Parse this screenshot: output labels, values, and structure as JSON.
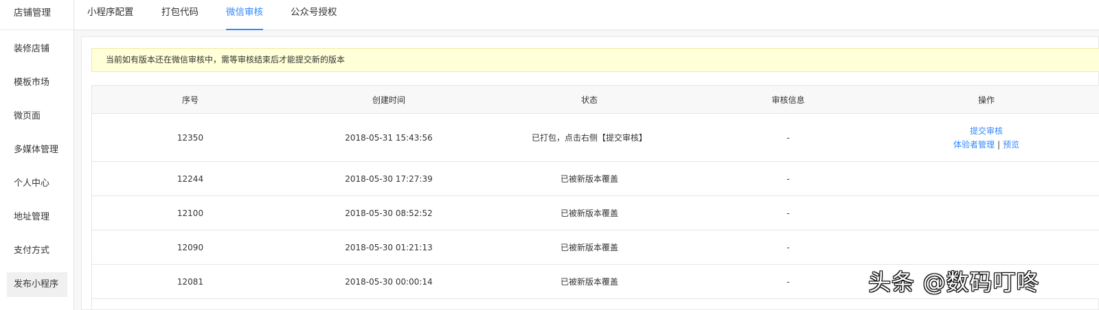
{
  "sidebar": {
    "title": "店铺管理",
    "items": [
      {
        "label": "装修店铺"
      },
      {
        "label": "模板市场"
      },
      {
        "label": "微页面"
      },
      {
        "label": "多媒体管理"
      },
      {
        "label": "个人中心"
      },
      {
        "label": "地址管理"
      },
      {
        "label": "支付方式"
      },
      {
        "label": "发布小程序",
        "active": true
      }
    ]
  },
  "tabs": [
    {
      "label": "小程序配置"
    },
    {
      "label": "打包代码"
    },
    {
      "label": "微信审核",
      "active": true
    },
    {
      "label": "公众号授权"
    }
  ],
  "notice": "当前如有版本还在微信审核中，需等审核结束后才能提交新的版本",
  "table": {
    "headers": [
      "序号",
      "创建时间",
      "状态",
      "审核信息",
      "操作"
    ],
    "rows": [
      {
        "id": "12350",
        "time": "2018-05-31 15:43:56",
        "status": "已打包，点击右侧【提交审核】",
        "info": "-",
        "actions": {
          "submit": "提交审核",
          "testers": "体验者管理",
          "sep": "|",
          "preview": "预览"
        }
      },
      {
        "id": "12244",
        "time": "2018-05-30 17:27:39",
        "status": "已被新版本覆盖",
        "info": "-"
      },
      {
        "id": "12100",
        "time": "2018-05-30 08:52:52",
        "status": "已被新版本覆盖",
        "info": "-"
      },
      {
        "id": "12090",
        "time": "2018-05-30 01:21:13",
        "status": "已被新版本覆盖",
        "info": "-"
      },
      {
        "id": "12081",
        "time": "2018-05-30 00:00:14",
        "status": "已被新版本覆盖",
        "info": "-"
      }
    ]
  },
  "watermark": "头条 @数码叮咚",
  "colors": {
    "accent": "#3388ff",
    "notice_bg": "#ffffd8"
  }
}
